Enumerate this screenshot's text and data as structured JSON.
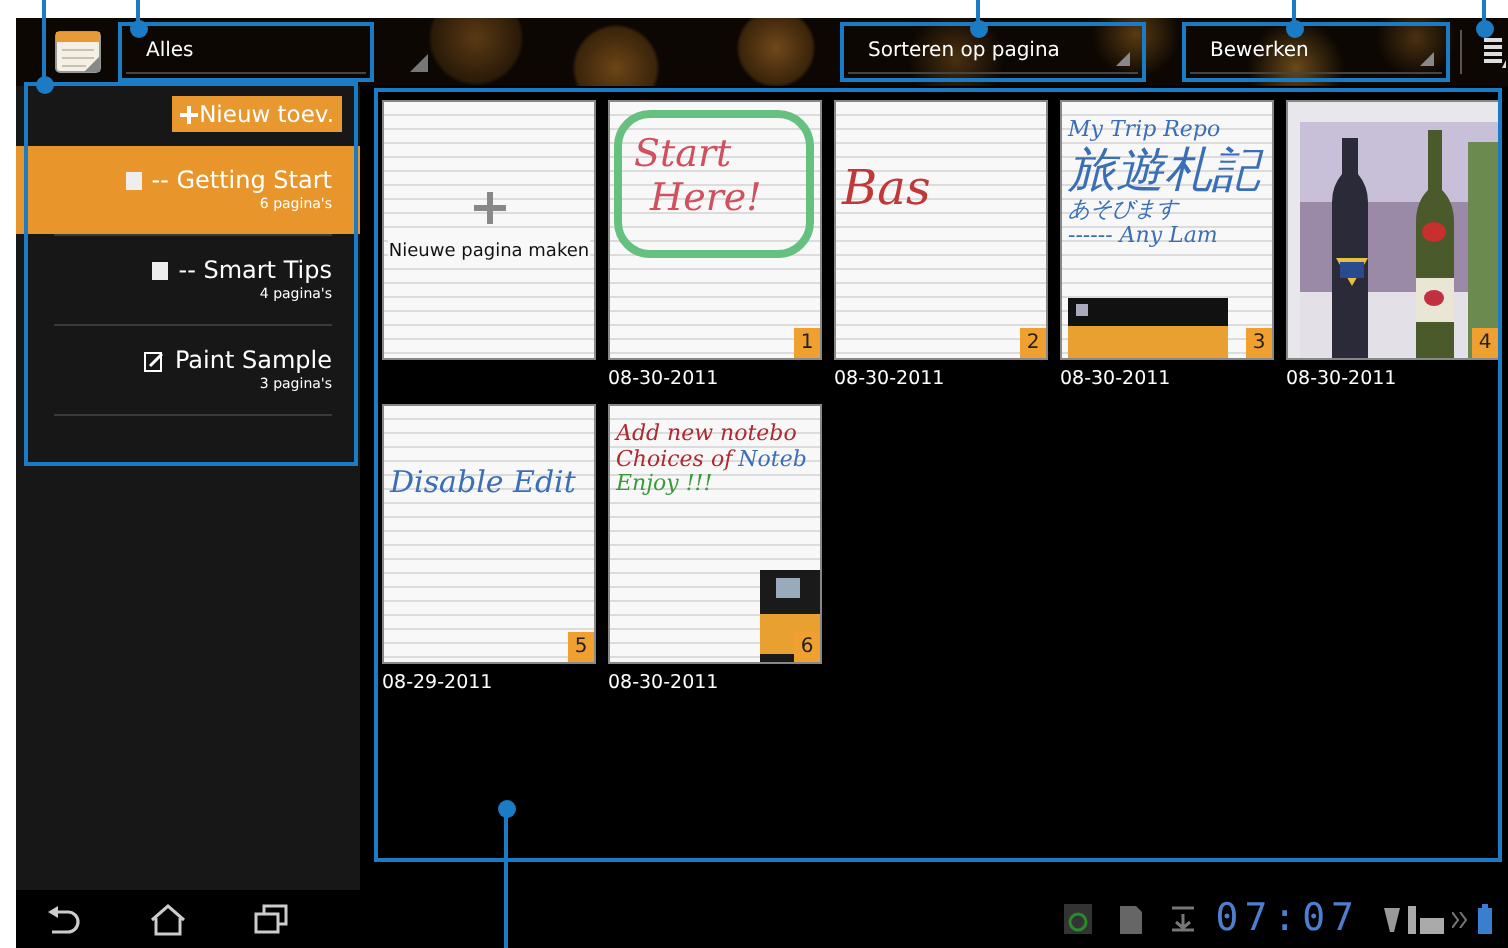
{
  "app_bar": {
    "folder": "Alles",
    "sort": "Sorteren op pagina",
    "edit": "Bewerken"
  },
  "sidebar": {
    "add_button": "Nieuw toev.",
    "notebooks": [
      {
        "title": "-- Getting Start",
        "pages": "6 pagina's",
        "selected": true,
        "kind": "note"
      },
      {
        "title": "-- Smart Tips",
        "pages": "4 pagina's",
        "selected": false,
        "kind": "note"
      },
      {
        "title": "Paint Sample",
        "pages": "3 pagina's",
        "selected": false,
        "kind": "paint"
      }
    ]
  },
  "pages": [
    {
      "kind": "new",
      "label": "Nieuwe pagina maken"
    },
    {
      "kind": "note",
      "number": "1",
      "date": "08-30-2011",
      "framed": true,
      "handwriting": [
        {
          "segments": [
            {
              "text": "Start",
              "color": "#d05060"
            }
          ]
        },
        {
          "segments": [
            {
              "text": "Here!",
              "color": "#d05060"
            }
          ]
        }
      ]
    },
    {
      "kind": "note",
      "number": "2",
      "date": "08-30-2011",
      "handwriting": [
        {
          "segments": [
            {
              "text": "Bas",
              "color": "#c03838"
            }
          ]
        }
      ]
    },
    {
      "kind": "note",
      "number": "3",
      "date": "08-30-2011",
      "inset": true,
      "handwriting": [
        {
          "segments": [
            {
              "text": "My Trip Repo",
              "color": "#3a6fb8"
            }
          ]
        },
        {
          "segments": [
            {
              "text": "旅遊札記",
              "color": "#3a6fb8"
            }
          ]
        },
        {
          "segments": [
            {
              "text": "あそびます",
              "color": "#3a6fb8"
            }
          ]
        },
        {
          "segments": [
            {
              "text": "------ Any Lam",
              "color": "#3a6fb8"
            }
          ]
        }
      ]
    },
    {
      "number": "4",
      "date": "08-30-2011"
    },
    {
      "kind": "note",
      "number": "5",
      "date": "08-29-2011",
      "handwriting": [
        {
          "segments": [
            {
              "text": "Disable Edit",
              "color": "#3a6fb8"
            }
          ]
        }
      ]
    },
    {
      "kind": "note",
      "number": "6",
      "date": "08-30-2011",
      "inset": true,
      "handwriting": [
        {
          "segments": [
            {
              "text": "Add new notebo",
              "color": "#b02830"
            }
          ]
        },
        {
          "segments": [
            {
              "text": "Choices of",
              "color": "#b02830"
            },
            {
              "text": "Noteb",
              "color": "#3a6fb8"
            }
          ]
        },
        {
          "segments": [
            {
              "text": "Enjoy !!!",
              "color": "#3a9a3a"
            }
          ]
        }
      ]
    }
  ],
  "status_bar": {
    "time": "07:07"
  }
}
